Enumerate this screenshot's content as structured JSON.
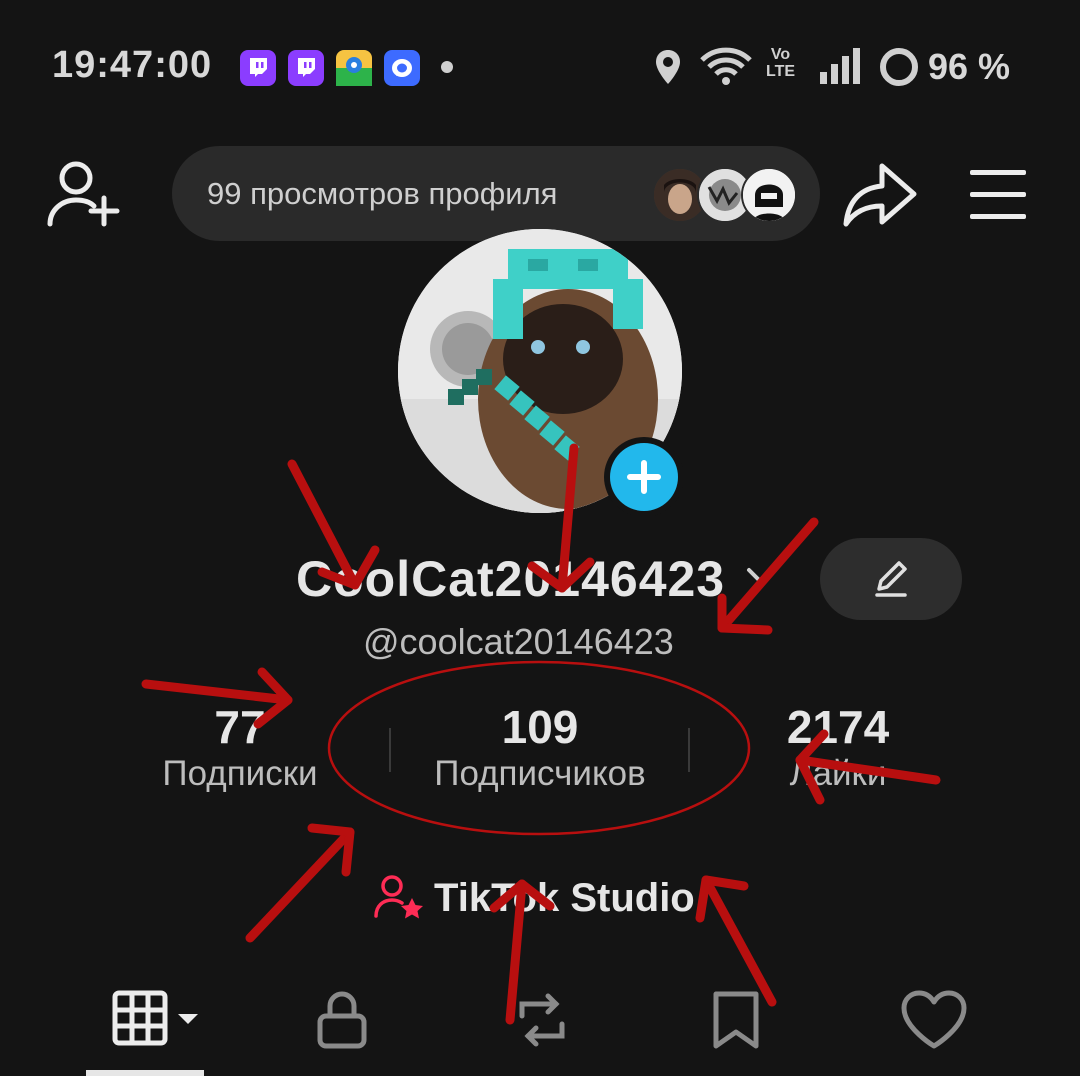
{
  "status_bar": {
    "time": "19:47:00",
    "battery": "96 %",
    "network_label_top": "Vo",
    "network_label_bottom": "LTE",
    "notification_icons": [
      "twitch-icon",
      "twitch-icon",
      "maps-app-icon",
      "messenger-icon"
    ]
  },
  "top_bar": {
    "profile_views": "99 просмотров профиля",
    "icons": [
      "add-friend-icon",
      "share-icon",
      "menu-icon"
    ]
  },
  "profile": {
    "display_name": "CoolCat20146423",
    "handle": "@coolcat20146423"
  },
  "stats": [
    {
      "value": "77",
      "label": "Подписки"
    },
    {
      "value": "109",
      "label": "Подписчиков"
    },
    {
      "value": "2174",
      "label": "Лайки"
    }
  ],
  "studio": {
    "label": "TikTok Studio",
    "icon_color": "#fe2c55"
  },
  "tabs": [
    "grid-icon",
    "lock-icon",
    "repost-icon",
    "bookmark-icon",
    "heart-icon"
  ],
  "colors": {
    "background": "#141414",
    "accent_blue": "#22b8ec",
    "annotation_red": "#b80f0f"
  }
}
